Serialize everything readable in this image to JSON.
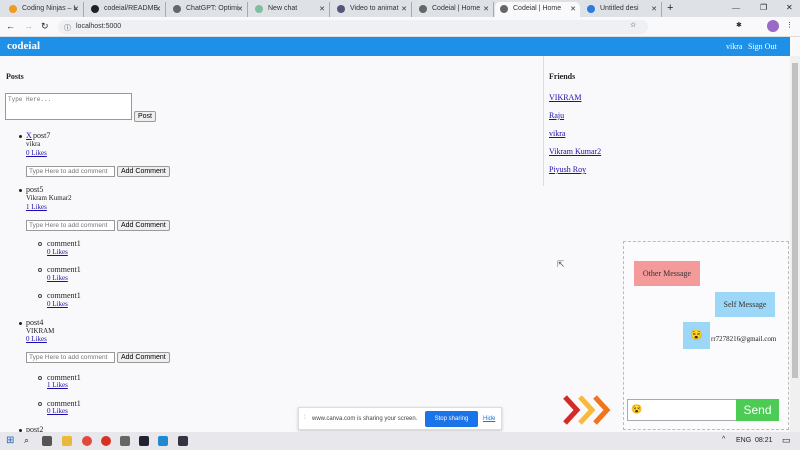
{
  "browser": {
    "tabs": [
      {
        "label": "Coding Ninjas – L"
      },
      {
        "label": "codeial/README."
      },
      {
        "label": "ChatGPT: Optimi"
      },
      {
        "label": "New chat"
      },
      {
        "label": "Video to animat"
      },
      {
        "label": "Codeial | Home"
      },
      {
        "label": "Codeial | Home"
      },
      {
        "label": "Untitled desi"
      }
    ],
    "url": "localhost:5000",
    "new_tab": "+"
  },
  "nav": {
    "brand": "codeial",
    "user": "vikra",
    "sign_out": "Sign Out"
  },
  "posts": {
    "heading": "Posts",
    "textarea_placeholder": "Type Here...",
    "post_button": "Post",
    "comment_placeholder": "Type Here to add comment",
    "add_comment": "Add Comment",
    "items": [
      {
        "delete": "X",
        "content": "post7",
        "author": "vikra",
        "likes": "0 Likes",
        "comments": []
      },
      {
        "content": "post5",
        "author": "Vikram Kumar2",
        "likes": "1 Likes",
        "comments": [
          {
            "content": "comment1",
            "likes": "0 Likes"
          },
          {
            "content": "comment1",
            "likes": "0 Likes"
          },
          {
            "content": "comment1",
            "likes": "0 Likes"
          }
        ]
      },
      {
        "content": "post4",
        "author": "VIKRAM",
        "likes": "0 Likes",
        "comments": [
          {
            "content": "comment1",
            "likes": "1 Likes"
          },
          {
            "content": "comment1",
            "likes": "0 Likes"
          }
        ]
      },
      {
        "content": "post2"
      }
    ]
  },
  "friends": {
    "heading": "Friends",
    "list": [
      "VIKRAM",
      "Raju",
      "vikra",
      "Vikram Kumar2",
      "Piyush Roy"
    ]
  },
  "chat": {
    "other": "Other Message",
    "self": "Self Message",
    "email": "rr7278216@gmail.com",
    "send": "Send",
    "emoji": "😵"
  },
  "share_bar": {
    "text": "www.canva.com is sharing your screen.",
    "stop": "Stop sharing",
    "hide": "Hide"
  },
  "taskbar": {
    "lang": "ENG",
    "time": "08:21"
  }
}
